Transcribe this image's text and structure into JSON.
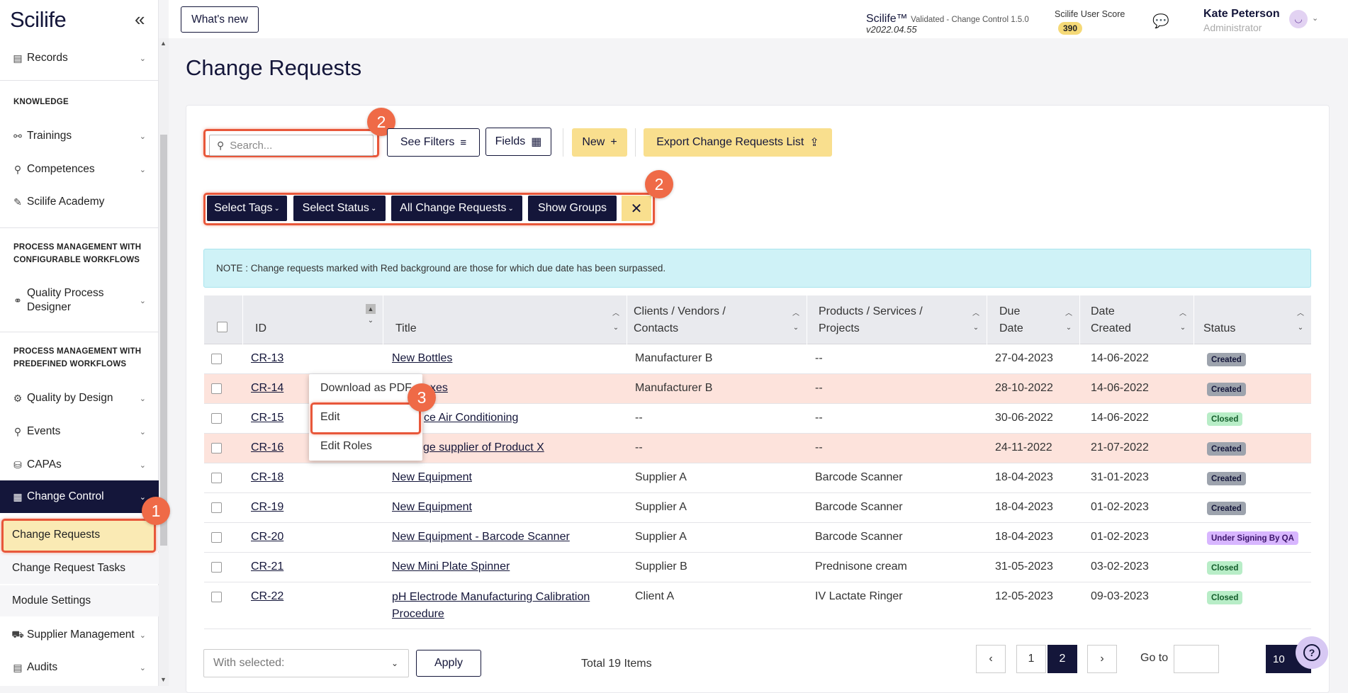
{
  "app": {
    "logo": "Scilife",
    "collapse_icon": "double-chevron-left-icon"
  },
  "sidebar": {
    "records": "Records",
    "section_knowledge": "KNOWLEDGE",
    "trainings": "Trainings",
    "competences": "Competences",
    "academy": "Scilife Academy",
    "section_configurable_1": "PROCESS MANAGEMENT WITH",
    "section_configurable_2": "CONFIGURABLE WORKFLOWS",
    "qpd_1": "Quality Process",
    "qpd_2": "Designer",
    "section_predefined_1": "PROCESS MANAGEMENT WITH",
    "section_predefined_2": "PREDEFINED WORKFLOWS",
    "qbd": "Quality by Design",
    "events": "Events",
    "capas": "CAPAs",
    "change_control": "Change Control",
    "change_requests": "Change Requests",
    "change_request_tasks": "Change Request Tasks",
    "module_settings": "Module Settings",
    "supplier_mgmt": "Supplier Management",
    "audits": "Audits"
  },
  "topbar": {
    "whats_new": "What's new",
    "product": "Scilife™",
    "validated": "Validated - Change Control 1.5.0",
    "version": "v2022.04.55",
    "score_label": "Scilife User Score",
    "score": "390",
    "user_name": "Kate Peterson",
    "user_role": "Administrator"
  },
  "page": {
    "title": "Change Requests"
  },
  "toolbar": {
    "search_placeholder": "Search...",
    "see_filters": "See Filters",
    "fields": "Fields",
    "new": "New",
    "new_icon": "+",
    "export": "Export Change Requests List"
  },
  "filters": {
    "tags": "Select Tags",
    "status": "Select Status",
    "all": "All Change Requests",
    "groups": "Show Groups",
    "clear": "✕"
  },
  "note": "NOTE : Change requests marked with Red background are those for which due date has been surpassed.",
  "table": {
    "headers": {
      "id": "ID",
      "title": "Title",
      "clients_1": "Clients / Vendors /",
      "clients_2": "Contacts",
      "products_1": "Products / Services /",
      "products_2": "Projects",
      "due_1": "Due",
      "due_2": "Date",
      "created_1": "Date",
      "created_2": "Created",
      "status": "Status"
    },
    "rows": [
      {
        "id": "CR-13",
        "title": "New Bottles",
        "client": "Manufacturer B",
        "product": "--",
        "due": "27-04-2023",
        "created": "14-06-2022",
        "status": "Created"
      },
      {
        "id": "CR-14",
        "title": "xes",
        "client": "Manufacturer B",
        "product": "--",
        "due": "28-10-2022",
        "created": "14-06-2022",
        "status": "Created"
      },
      {
        "id": "CR-15",
        "title": "ce Air Conditioning",
        "client": "--",
        "product": "--",
        "due": "30-06-2022",
        "created": "14-06-2022",
        "status": "Closed"
      },
      {
        "id": "CR-16",
        "title": "ge supplier of Product X",
        "client": "--",
        "product": "--",
        "due": "24-11-2022",
        "created": "21-07-2022",
        "status": "Created"
      },
      {
        "id": "CR-18",
        "title": "New Equipment",
        "client": "Supplier A",
        "product": "Barcode Scanner",
        "due": "18-04-2023",
        "created": "31-01-2023",
        "status": "Created"
      },
      {
        "id": "CR-19",
        "title": "New Equipment",
        "client": "Supplier A",
        "product": "Barcode Scanner",
        "due": "18-04-2023",
        "created": "01-02-2023",
        "status": "Created"
      },
      {
        "id": "CR-20",
        "title": "New Equipment - Barcode Scanner",
        "client": "Supplier A",
        "product": "Barcode Scanner",
        "due": "18-04-2023",
        "created": "01-02-2023",
        "status": "Under Signing By QA"
      },
      {
        "id": "CR-21",
        "title": "New Mini Plate Spinner",
        "client": "Supplier B",
        "product": "Prednisone cream",
        "due": "31-05-2023",
        "created": "03-02-2023",
        "status": "Closed"
      },
      {
        "id": "CR-22",
        "title": "pH Electrode Manufacturing Calibration",
        "title2": "Procedure",
        "client": "Client A",
        "product": "IV Lactate Ringer",
        "due": "12-05-2023",
        "created": "09-03-2023",
        "status": "Closed"
      }
    ]
  },
  "context_menu": {
    "download": "Download as PDF",
    "edit": "Edit",
    "edit_roles": "Edit Roles"
  },
  "footer": {
    "with_selected": "With selected:",
    "apply": "Apply",
    "total": "Total 19 Items",
    "prev": "‹",
    "page1": "1",
    "page2": "2",
    "next": "›",
    "goto": "Go to",
    "page_size": "10"
  },
  "callouts": {
    "one": "1",
    "two": "2",
    "three": "3"
  },
  "colors": {
    "navy": "#14163a",
    "yellow": "#f9df8e",
    "callout": "#ef6a47",
    "overdue_row": "#fde3dc"
  }
}
